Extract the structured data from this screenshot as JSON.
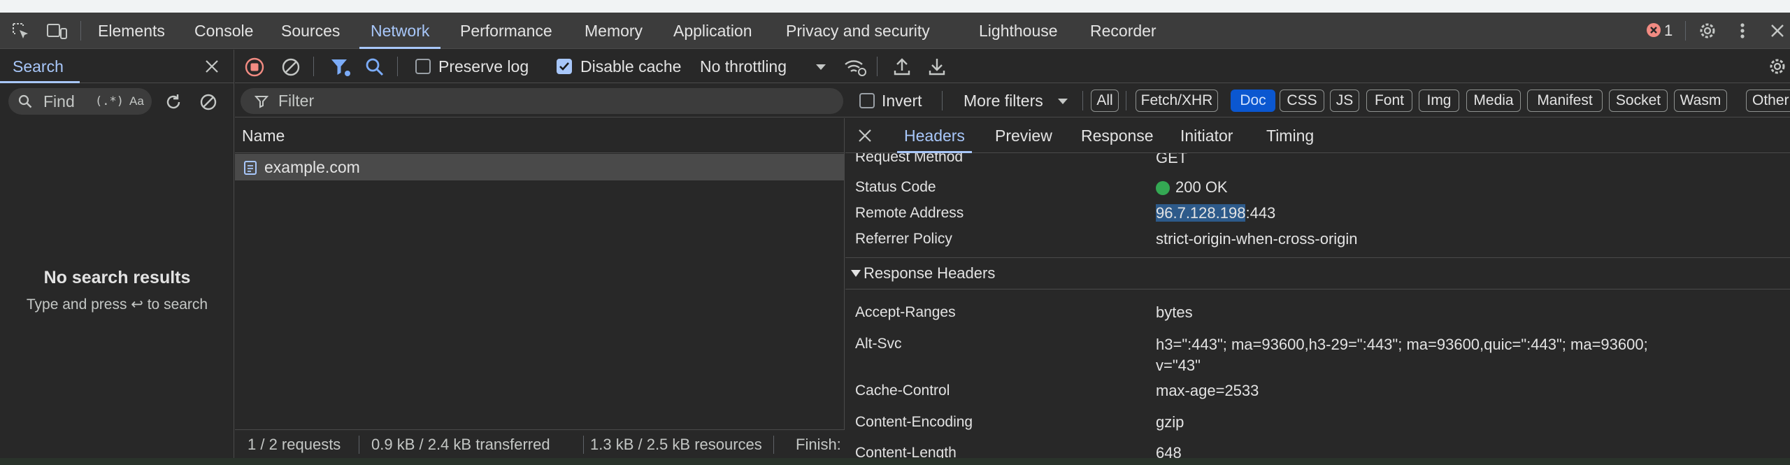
{
  "main_tabs": [
    "Elements",
    "Console",
    "Sources",
    "Network",
    "Performance",
    "Memory",
    "Application",
    "Privacy and security",
    "Lighthouse",
    "Recorder"
  ],
  "active_main_tab": "Network",
  "error_count": "1",
  "search_panel": {
    "title": "Search",
    "find_placeholder": "Find",
    "regex_label": "(.*)",
    "case_label": "Aa",
    "no_results": "No search results",
    "hint": "Type and press ↩ to search"
  },
  "network_toolbar": {
    "preserve_log": {
      "label": "Preserve log",
      "checked": false
    },
    "disable_cache": {
      "label": "Disable cache",
      "checked": true
    },
    "throttling": "No throttling"
  },
  "filter_row": {
    "filter_placeholder": "Filter",
    "invert_label": "Invert",
    "more_filters": "More filters",
    "type_filters": [
      "All",
      "Fetch/XHR",
      "Doc",
      "CSS",
      "JS",
      "Font",
      "Img",
      "Media",
      "Manifest",
      "Socket",
      "Wasm",
      "Other"
    ],
    "active_filter": "Doc"
  },
  "request_list": {
    "column_name": "Name",
    "rows": [
      {
        "name": "example.com"
      }
    ]
  },
  "status_bar": {
    "requests": "1 / 2 requests",
    "transferred": "0.9 kB / 2.4 kB transferred",
    "resources": "1.3 kB / 2.5 kB resources",
    "finish": "Finish:"
  },
  "details": {
    "tabs": [
      "Headers",
      "Preview",
      "Response",
      "Initiator",
      "Timing"
    ],
    "active_tab": "Headers",
    "general": [
      {
        "key": "Request Method",
        "value": "GET"
      },
      {
        "key": "Status Code",
        "value": "200 OK"
      },
      {
        "key": "Remote Address",
        "value_selected": "96.7.128.198",
        "value_rest": ":443"
      },
      {
        "key": "Referrer Policy",
        "value": "strict-origin-when-cross-origin"
      }
    ],
    "response_headers_title": "Response Headers",
    "response_headers": [
      {
        "key": "Accept-Ranges",
        "value": "bytes"
      },
      {
        "key": "Alt-Svc",
        "value": "h3=\":443\"; ma=93600,h3-29=\":443\"; ma=93600,quic=\":443\"; ma=93600;",
        "value2": "v=\"43\""
      },
      {
        "key": "Cache-Control",
        "value": "max-age=2533"
      },
      {
        "key": "Content-Encoding",
        "value": "gzip"
      },
      {
        "key": "Content-Length",
        "value": "648"
      }
    ]
  },
  "colors": {
    "accent": "#a8c7fa",
    "status_ok": "#34a853",
    "error_red": "#f28b82",
    "record_red": "#f28b82",
    "active_pill": "#0b57d0"
  }
}
